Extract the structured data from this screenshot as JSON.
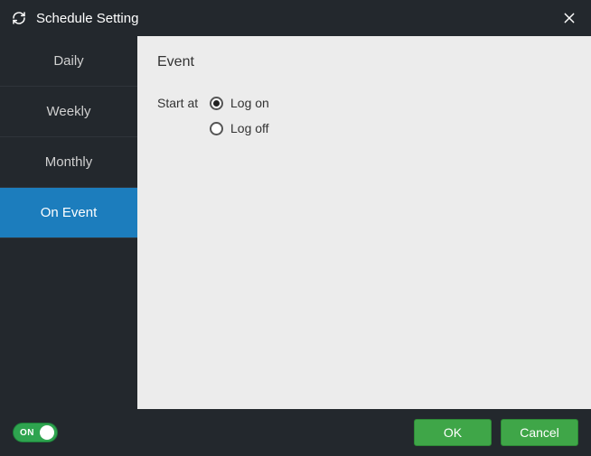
{
  "titlebar": {
    "title": "Schedule Setting"
  },
  "sidebar": {
    "items": [
      {
        "label": "Daily",
        "selected": false
      },
      {
        "label": "Weekly",
        "selected": false
      },
      {
        "label": "Monthly",
        "selected": false
      },
      {
        "label": "On Event",
        "selected": true
      }
    ]
  },
  "content": {
    "heading": "Event",
    "start_label": "Start at",
    "options": [
      {
        "label": "Log on",
        "checked": true
      },
      {
        "label": "Log off",
        "checked": false
      }
    ]
  },
  "footer": {
    "toggle_label": "ON",
    "ok": "OK",
    "cancel": "Cancel"
  }
}
